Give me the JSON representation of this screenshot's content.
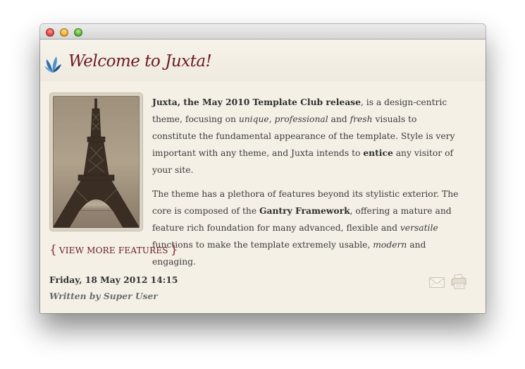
{
  "window": {
    "close_label": "close",
    "minimize_label": "minimize",
    "zoom_label": "zoom"
  },
  "header": {
    "logo_icon": "juxta-leaf-logo-icon",
    "title": "Welcome to Juxta!"
  },
  "article": {
    "image_subject": "eiffel-tower-photo",
    "p1": {
      "lead_bold": "Juxta, the May 2010 Template Club release",
      "t1": ", is a design-centric theme, focusing on ",
      "em1": "unique",
      "t2": ", ",
      "em2": "professional",
      "t3": " and ",
      "em3": "fresh",
      "t4": " visuals to constitute the fundamental appearance of the template. Style is very important with any theme, and Juxta intends to ",
      "bold2": "entice",
      "t5": " any visitor of your site."
    },
    "p2": {
      "t1": "The theme has a plethora of features beyond its stylistic exterior. The core is composed of the ",
      "bold1": "Gantry Framework",
      "t2": ", offering a mature and feature rich foundation for many advanced, flexible and ",
      "em1": "versatile",
      "t3": " functions to make the template extremely usable, ",
      "em2": "modern",
      "t4": " and engaging."
    },
    "view_more": {
      "open_brace": "{",
      "label": "VIEW MORE FEATURES",
      "close_brace": "}"
    },
    "date": "Friday, 18 May 2012 14:15",
    "author": "Written by Super User",
    "actions": {
      "email_icon": "email-icon",
      "print_icon": "print-icon"
    }
  },
  "colors": {
    "accent": "#6b1a24",
    "background": "#f4f0e6",
    "text": "#3a3a3a",
    "author": "#6d6d72"
  }
}
